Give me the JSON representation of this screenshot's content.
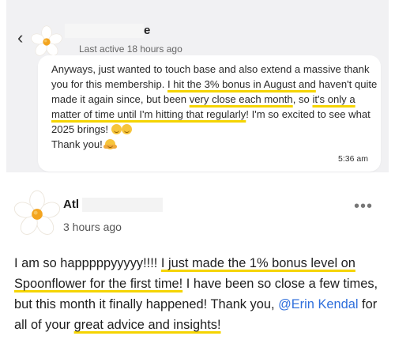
{
  "chat": {
    "back_icon": "chevron-left-icon",
    "avatar_icon": "daisy-flower-icon",
    "contact_name_tail": "e",
    "last_active": "Last active 18 hours ago",
    "message": {
      "p1": "Anyways, just wanted to touch base and also extend a massive thank you for this membership. ",
      "hl1": "I hit the 3% bonus in August and",
      "p2": " haven't quite made it again since, but been ",
      "hl2": "very close each month",
      "p3": ", so ",
      "hl3": "it's only a matter of time until I'm hitting that regularly",
      "p4": "!  I'm so excited to see what 2025 brings! ",
      "thanks": "Thank you! "
    },
    "time": "5:36 am"
  },
  "post": {
    "avatar_icon": "daisy-flower-icon",
    "author_visible": "Atl",
    "time": "3 hours ago",
    "more_label": "•••",
    "body": {
      "p1": "I am so happpppyyyyy!!!! ",
      "hl1": "I just made the 1% bonus level on Spoonflower for the first time!",
      "p2": " I have been so close a few times, but this month it finally happened! Thank you, ",
      "mention": "@Erin Kendal",
      "p3": " for all of your ",
      "hl2": "great advice and insights!"
    }
  },
  "colors": {
    "highlight": "#f5d400",
    "mention": "#2f6fdc",
    "panel_bg": "#f1f1f3"
  }
}
